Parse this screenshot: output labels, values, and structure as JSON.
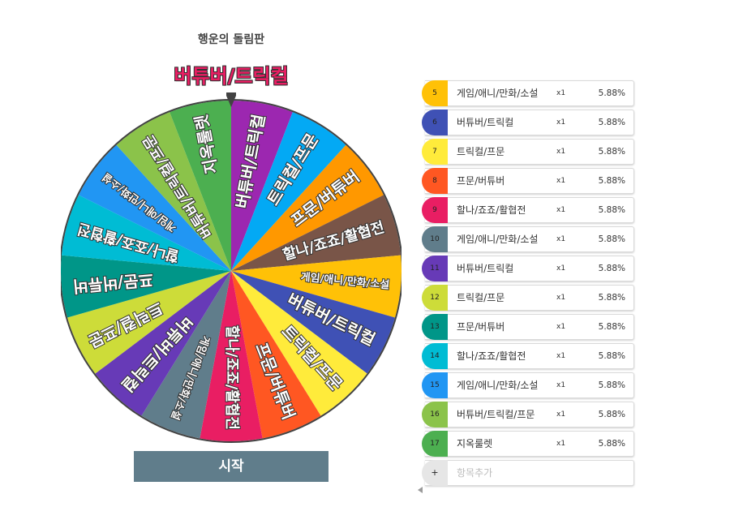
{
  "title": "행운의 돌림판",
  "result": "버튜버/트릭컬",
  "start_label": "시작",
  "wheel": {
    "segments": [
      {
        "label": "버튜버/트릭컬",
        "color": "#9c27b0"
      },
      {
        "label": "트릭컬/프문",
        "color": "#03a9f4"
      },
      {
        "label": "프문/버튜버",
        "color": "#ff9800"
      },
      {
        "label": "할나/죠죠/활협전",
        "color": "#795548"
      },
      {
        "label": "게임/애니/만화/소설",
        "color": "#ffc107"
      },
      {
        "label": "버튜버/트릭컬",
        "color": "#3f51b5"
      },
      {
        "label": "트릭컬/프문",
        "color": "#ffeb3b"
      },
      {
        "label": "프문/버튜버",
        "color": "#ff5722"
      },
      {
        "label": "할나/죠죠/활협전",
        "color": "#e91e63"
      },
      {
        "label": "게임/애니/만화/소설",
        "color": "#607d8b"
      },
      {
        "label": "버튜버/트릭컬",
        "color": "#673ab7"
      },
      {
        "label": "트릭컬/프문",
        "color": "#cddc39"
      },
      {
        "label": "프문/버튜버",
        "color": "#009688"
      },
      {
        "label": "할나/죠죠/활협전",
        "color": "#00bcd4"
      },
      {
        "label": "게임/애니/만화/소설",
        "color": "#2196f3"
      },
      {
        "label": "버튜버/트릭컬/프문",
        "color": "#8bc34a"
      },
      {
        "label": "지옥룰렛",
        "color": "#4caf50"
      }
    ]
  },
  "list": {
    "items": [
      {
        "num": "5",
        "name": "게임/애니/만화/소설",
        "mult": "x1",
        "pct": "5.88%",
        "color": "#ffc107"
      },
      {
        "num": "6",
        "name": "버튜버/트릭컬",
        "mult": "x1",
        "pct": "5.88%",
        "color": "#3f51b5"
      },
      {
        "num": "7",
        "name": "트릭컬/프문",
        "mult": "x1",
        "pct": "5.88%",
        "color": "#ffeb3b"
      },
      {
        "num": "8",
        "name": "프문/버튜버",
        "mult": "x1",
        "pct": "5.88%",
        "color": "#ff5722"
      },
      {
        "num": "9",
        "name": "할나/죠죠/활협전",
        "mult": "x1",
        "pct": "5.88%",
        "color": "#e91e63"
      },
      {
        "num": "10",
        "name": "게임/애니/만화/소설",
        "mult": "x1",
        "pct": "5.88%",
        "color": "#607d8b"
      },
      {
        "num": "11",
        "name": "버튜버/트릭컬",
        "mult": "x1",
        "pct": "5.88%",
        "color": "#673ab7"
      },
      {
        "num": "12",
        "name": "트릭컬/프문",
        "mult": "x1",
        "pct": "5.88%",
        "color": "#cddc39"
      },
      {
        "num": "13",
        "name": "프문/버튜버",
        "mult": "x1",
        "pct": "5.88%",
        "color": "#009688"
      },
      {
        "num": "14",
        "name": "할나/죠죠/활협전",
        "mult": "x1",
        "pct": "5.88%",
        "color": "#00bcd4"
      },
      {
        "num": "15",
        "name": "게임/애니/만화/소설",
        "mult": "x1",
        "pct": "5.88%",
        "color": "#2196f3"
      },
      {
        "num": "16",
        "name": "버튜버/트릭컬/프문",
        "mult": "x1",
        "pct": "5.88%",
        "color": "#8bc34a"
      },
      {
        "num": "17",
        "name": "지옥룰렛",
        "mult": "x1",
        "pct": "5.88%",
        "color": "#4caf50"
      }
    ],
    "add": {
      "icon": "+",
      "label": "항목추가"
    }
  }
}
